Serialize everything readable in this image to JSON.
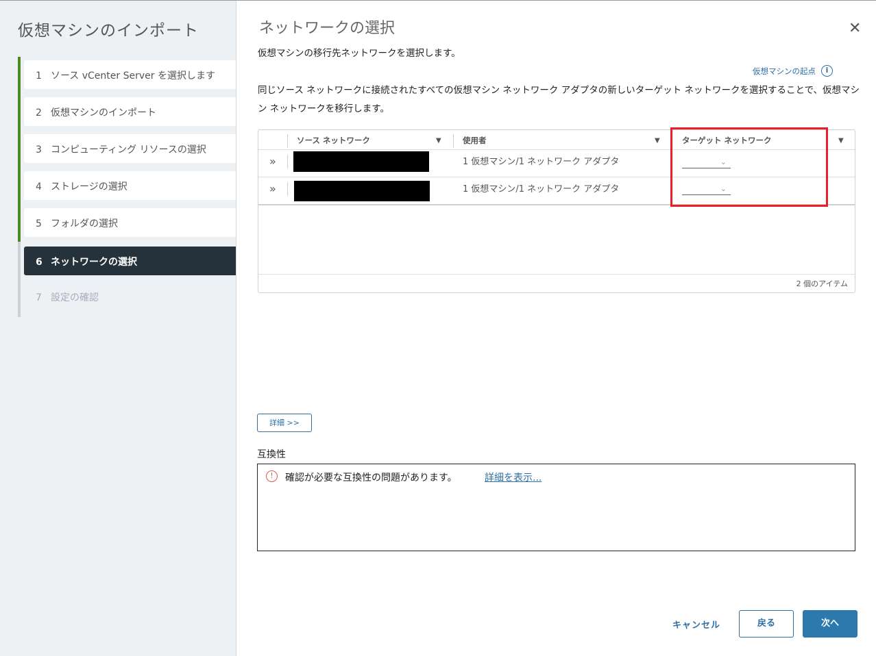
{
  "sidebar": {
    "title": "仮想マシンのインポート",
    "steps": [
      {
        "num": "1",
        "label": "ソース vCenter Server を選択します"
      },
      {
        "num": "2",
        "label": "仮想マシンのインポート"
      },
      {
        "num": "3",
        "label": "コンピューティング リソースの選択"
      },
      {
        "num": "4",
        "label": "ストレージの選択"
      },
      {
        "num": "5",
        "label": "フォルダの選択"
      },
      {
        "num": "6",
        "label": "ネットワークの選択"
      },
      {
        "num": "7",
        "label": "設定の確認"
      }
    ],
    "active_step": 6
  },
  "main": {
    "title": "ネットワークの選択",
    "close": "✕",
    "description": "仮想マシンの移行先ネットワークを選択します。",
    "origin_link": "仮想マシンの起点",
    "info_icon": "i",
    "paragraph": "同じソース ネットワークに接続されたすべての仮想マシン ネットワーク アダプタの新しいターゲット ネットワークを選択することで、仮想マシン ネットワークを移行します。",
    "table": {
      "columns": [
        "ソース ネットワーク",
        "使用者",
        "ターゲット ネットワーク"
      ],
      "rows": [
        {
          "user": "1 仮想マシン/1 ネットワーク アダプタ",
          "target": ""
        },
        {
          "user": "1 仮想マシン/1 ネットワーク アダプタ",
          "target": ""
        }
      ],
      "footer": "2 個のアイテム"
    },
    "details_button": "詳細 >>",
    "compatibility": {
      "label": "互換性",
      "message": "確認が必要な互換性の問題があります。",
      "link": "詳細を表示..."
    },
    "buttons": {
      "cancel": "キャンセル",
      "back": "戻る",
      "next": "次へ"
    }
  }
}
